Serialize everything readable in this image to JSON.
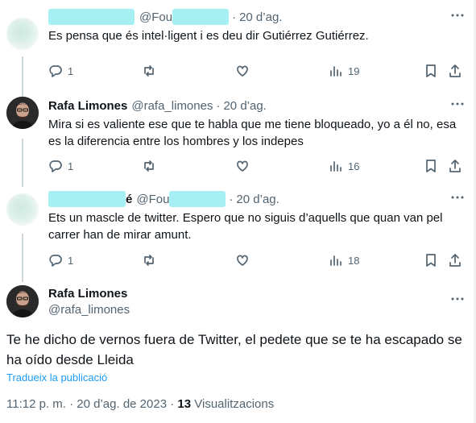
{
  "replies": [
    {
      "name": "",
      "handle": "@Fou",
      "separator": "·",
      "date": "20 d’ag.",
      "text": "Es pensa que és intel·ligent i es deu dir Gutiérrez Gutiérrez.",
      "reply_count": "1",
      "retweet_count": "",
      "like_count": "",
      "views": "19",
      "avatar": "blurred-avatar"
    },
    {
      "name": "Rafa Limones",
      "handle": "@rafa_limones",
      "separator": "·",
      "date": "20 d’ag.",
      "text": "Mira si es valiente ese que te habla que me tiene bloqueado, yo a él no, esa es la diferencia entre los hombres y los indepes",
      "reply_count": "1",
      "retweet_count": "",
      "like_count": "",
      "views": "16",
      "avatar": "profile-photo"
    },
    {
      "name": "é",
      "handle": "@Fou",
      "separator": "·",
      "date": "20 d’ag.",
      "text": "Ets un mascle de twitter. Espero que no siguis d’aquells que quan van pel carrer han de mirar amunt.",
      "reply_count": "1",
      "retweet_count": "",
      "like_count": "",
      "views": "18",
      "avatar": "blurred-avatar"
    }
  ],
  "main_tweet": {
    "name": "Rafa Limones",
    "handle": "@rafa_limones",
    "text": "Te he dicho de vernos fuera de Twitter, el pedete que se te ha escapado se ha oído desde Lleida",
    "translate_label": "Tradueix la publicació",
    "time": "11:12 p. m.",
    "separator": "·",
    "date": "20 d’ag. de 2023",
    "view_count": "13",
    "view_label": "Visualitzacions"
  },
  "icons": {
    "reply": "reply-icon",
    "retweet": "retweet-icon",
    "like": "heart-icon",
    "views": "views-icon",
    "bookmark": "bookmark-icon",
    "share": "share-icon",
    "more": "more-icon"
  },
  "colors": {
    "link": "#1d9bf0",
    "secondary_text": "#536471",
    "redaction": "#a6f0f3"
  }
}
